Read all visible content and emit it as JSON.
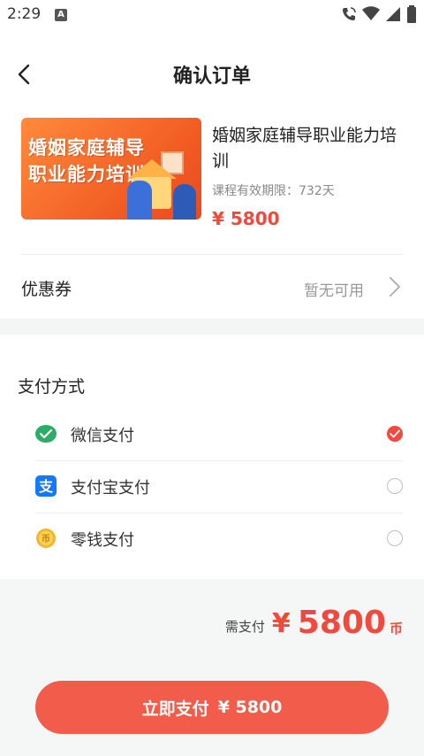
{
  "status_bar": {
    "time": "2:29",
    "notification_icon": "A"
  },
  "header": {
    "title": "确认订单"
  },
  "product": {
    "cover_line1": "婚姻家庭辅导",
    "cover_line2": "职业能力培训",
    "title": "婚姻家庭辅导职业能力培训",
    "validity": "课程有效期限：732天",
    "price": "¥ 5800"
  },
  "coupon": {
    "label": "优惠券",
    "value": "暂无可用"
  },
  "payment": {
    "section_title": "支付方式",
    "methods": [
      {
        "label": "微信支付",
        "icon": "wechat-pay-icon",
        "selected": true
      },
      {
        "label": "支付宝支付",
        "icon": "alipay-icon",
        "selected": false
      },
      {
        "label": "零钱支付",
        "icon": "coin-icon",
        "selected": false
      }
    ]
  },
  "summary": {
    "label": "需支付",
    "yen": "¥",
    "amount": "5800",
    "unit": "币"
  },
  "pay_button": {
    "label": "立即支付",
    "amount": "¥ 5800"
  },
  "colors": {
    "accent": "#f0493e",
    "button": "#f25d4b",
    "wechat": "#2aae67",
    "alipay": "#1677ff",
    "coin": "#f5b72a"
  }
}
